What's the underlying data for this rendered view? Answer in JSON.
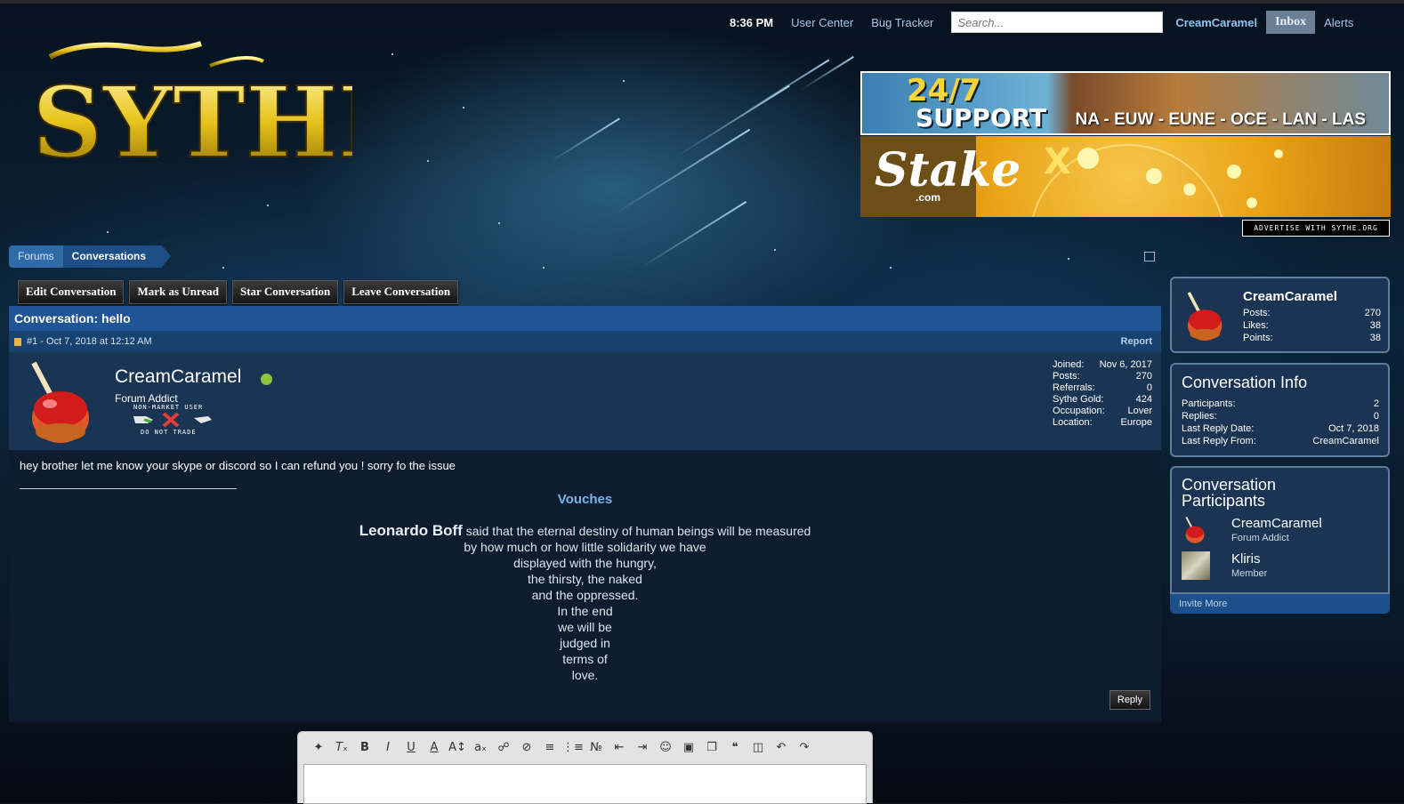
{
  "topnav": {
    "time": "8:36 PM",
    "user_center": "User Center",
    "bug_tracker": "Bug Tracker",
    "search_placeholder": "Search...",
    "username": "CreamCaramel",
    "inbox": "Inbox",
    "alerts": "Alerts"
  },
  "logo": {
    "text": "SYTHE",
    "color": "#e6c21b"
  },
  "ads": {
    "ad1_line1": "24/7",
    "ad1_line2": "SUPPORT",
    "ad1_regions": "NA - EUW - EUNE - OCE - LAN - LAS",
    "ad2_brand": "Stake",
    "ad2_com": ".com",
    "ad2_x": "X",
    "advertise": "ADVERTISE WITH SYTHE.ORG"
  },
  "breadcrumb": {
    "forums": "Forums",
    "conversations": "Conversations"
  },
  "actions": {
    "edit": "Edit Conversation",
    "mark_unread": "Mark as Unread",
    "star": "Star Conversation",
    "leave": "Leave Conversation"
  },
  "conversation": {
    "title": "Conversation: hello",
    "post_id": "#1 - Oct 7, 2018 at 12:12 AM",
    "report": "Report",
    "author": "CreamCaramel",
    "author_title": "Forum Addict",
    "badge_top": "NON-MARKET USER",
    "badge_bottom": "DO NOT TRADE",
    "stats": [
      {
        "label": "Joined:",
        "value": "Nov 6, 2017"
      },
      {
        "label": "Posts:",
        "value": "270"
      },
      {
        "label": "Referrals:",
        "value": "0"
      },
      {
        "label": "Sythe Gold:",
        "value": "424"
      },
      {
        "label": "Occupation:",
        "value": "Lover"
      },
      {
        "label": "Location:",
        "value": "Europe"
      }
    ],
    "message": "hey brother let me know your skype or discord so I can refund you ! sorry fo the issue",
    "vouches": "Vouches",
    "poem_author": "Leonardo Boff",
    "poem_first": "said that the eternal destiny of human beings will be measured",
    "poem_lines": [
      "by how much or how little solidarity we have",
      "displayed with the hungry,",
      "the thirsty, the naked",
      "and the oppressed.",
      "In the end",
      "we will be",
      "judged in",
      "terms of",
      "love."
    ],
    "reply": "Reply"
  },
  "editor": {
    "tools": [
      "wand-icon",
      "clear-format-icon",
      "bold-icon",
      "italic-icon",
      "underline-icon",
      "font-color-icon",
      "font-size-icon",
      "font-family-icon",
      "link-icon",
      "unlink-icon",
      "align-icon",
      "bullet-list-icon",
      "number-list-icon",
      "outdent-icon",
      "indent-icon",
      "smiley-icon",
      "image-icon",
      "media-icon",
      "quote-icon",
      "save-draft-icon",
      "undo-icon",
      "redo-icon"
    ]
  },
  "sidebar": {
    "visitor": {
      "name": "CreamCaramel",
      "stats": [
        {
          "label": "Posts:",
          "value": "270"
        },
        {
          "label": "Likes:",
          "value": "38"
        },
        {
          "label": "Points:",
          "value": "38"
        }
      ]
    },
    "info": {
      "title": "Conversation Info",
      "rows": [
        {
          "label": "Participants:",
          "value": "2"
        },
        {
          "label": "Replies:",
          "value": "0"
        },
        {
          "label": "Last Reply Date:",
          "value": "Oct 7, 2018"
        },
        {
          "label": "Last Reply From:",
          "value": "CreamCaramel"
        }
      ]
    },
    "participants": {
      "title_line1": "Conversation",
      "title_line2": "Participants",
      "list": [
        {
          "name": "CreamCaramel",
          "role": "Forum Addict"
        },
        {
          "name": "Kliris",
          "role": "Member"
        }
      ],
      "invite": "Invite More"
    }
  }
}
